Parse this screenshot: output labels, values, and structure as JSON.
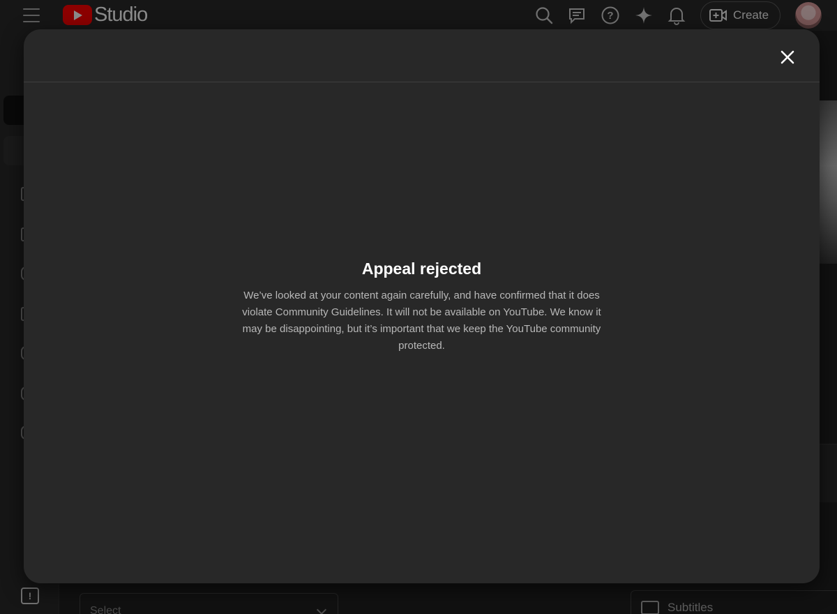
{
  "header": {
    "app_name": "Studio",
    "create_label": "Create",
    "icons": [
      "menu-icon",
      "search-icon",
      "feedback-icon",
      "help-icon",
      "sparkle-icon",
      "notifications-icon",
      "create-video-icon"
    ]
  },
  "background": {
    "select_placeholder": "Select",
    "subtitles_label": "Subtitles"
  },
  "dialog": {
    "title": "Appeal rejected",
    "message": "We’ve looked at your content again carefully, and have confirmed that it does violate Community Guidelines. It will not be available on YouTube. We know it may be disappointing, but it’s important that we keep the YouTube community protected.",
    "close_icon": "close-icon"
  },
  "colors": {
    "brand_red": "#ff0000",
    "dialog_bg": "#282828",
    "page_bg": "#1f1f1f"
  }
}
